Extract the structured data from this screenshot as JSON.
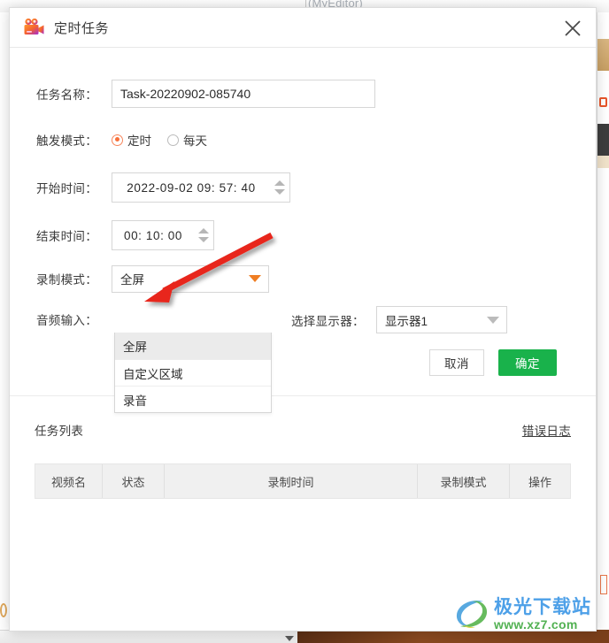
{
  "background": {
    "window_title_fragment": "(MyEditor)"
  },
  "watermark": {
    "name_cn": "极光下载站",
    "url": "www.xz7.com"
  },
  "dialog": {
    "titlebar": {
      "icon": "video-camera-icon",
      "title": "定时任务",
      "close_icon": "close-icon"
    },
    "form": {
      "task_name": {
        "label": "任务名称：",
        "value": "Task-20220902-085740",
        "placeholder": "Task-20220902-085740"
      },
      "trigger_mode": {
        "label": "触发模式：",
        "options": [
          "定时",
          "每天"
        ],
        "selected": "定时"
      },
      "start_time": {
        "label": "开始时间：",
        "value": "2022-09-02 09: 57: 40"
      },
      "end_time": {
        "label": "结束时间：",
        "value": "00: 10: 00"
      },
      "record_mode": {
        "label": "录制模式：",
        "selected": "全屏",
        "expanded": true,
        "options": [
          "全屏",
          "自定义区域",
          "录音"
        ],
        "highlighted": "全屏"
      },
      "monitor": {
        "label": "选择显示器：",
        "selected": "显示器1"
      },
      "audio_input": {
        "label": "音频输入："
      },
      "buttons": {
        "cancel": "取消",
        "confirm": "确定"
      }
    },
    "task_list": {
      "title": "任务列表",
      "error_log": "错误日志",
      "columns": [
        "视频名",
        "状态",
        "录制时间",
        "录制模式",
        "操作"
      ],
      "rows": []
    }
  },
  "colors": {
    "accent_orange": "#ef7d22",
    "radio_orange": "#f7703a",
    "confirm_green": "#19b24b",
    "annotation_red": "#e8251a",
    "watermark_blue": "#4da0e8",
    "watermark_green": "#52b152"
  }
}
